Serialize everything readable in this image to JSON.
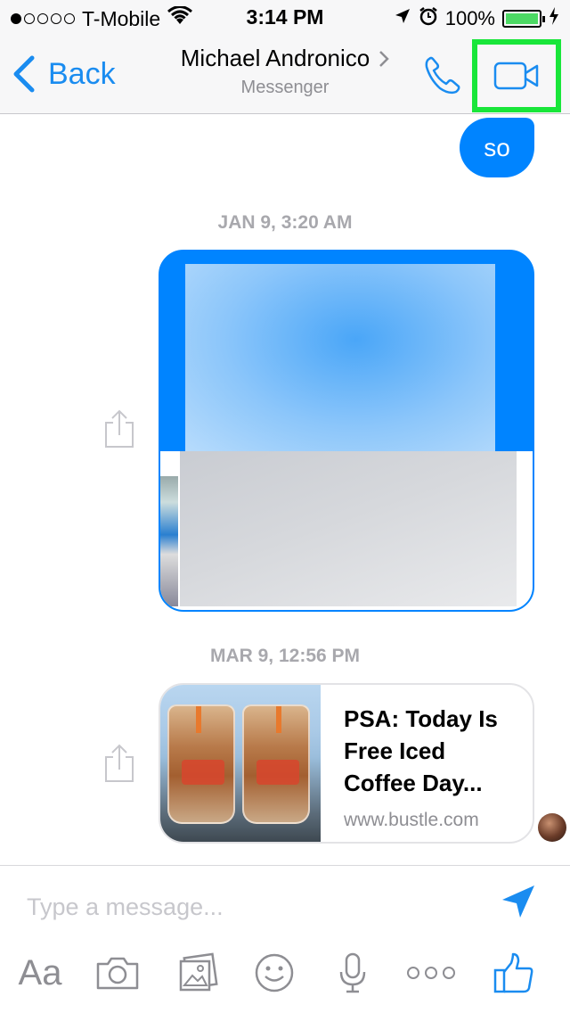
{
  "status_bar": {
    "carrier": "T-Mobile",
    "time": "3:14 PM",
    "battery_percent": "100%",
    "signal_bars_filled": 1,
    "signal_bars_total": 5
  },
  "nav": {
    "back_label": "Back",
    "contact_name": "Michael Andronico",
    "subtitle": "Messenger"
  },
  "messages": {
    "outgoing_text": "so",
    "timestamp_1": "JAN 9, 3:20 AM",
    "timestamp_2": "MAR 9, 12:56 PM",
    "link_card": {
      "title": "PSA: Today Is Free Iced Coffee Day...",
      "domain": "www.bustle.com"
    }
  },
  "composer": {
    "placeholder": "Type a message...",
    "aa_label": "Aa"
  },
  "colors": {
    "accent": "#0084ff",
    "highlight": "#19e63a",
    "battery": "#4cd964"
  },
  "icons": [
    "back-chevron-icon",
    "phone-icon",
    "video-camera-icon",
    "share-icon",
    "send-icon",
    "camera-icon",
    "gallery-icon",
    "smiley-icon",
    "microphone-icon",
    "more-icon",
    "thumbs-up-icon",
    "wifi-icon",
    "location-arrow-icon",
    "alarm-clock-icon",
    "charging-icon"
  ]
}
